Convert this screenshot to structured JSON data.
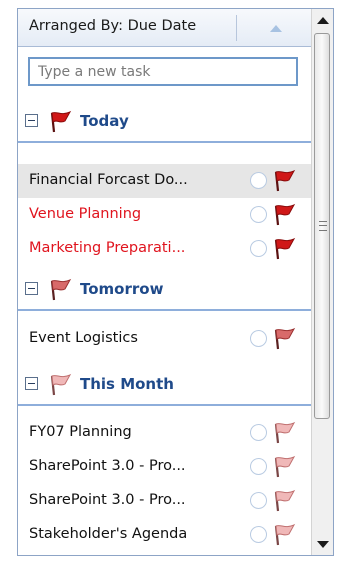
{
  "header": {
    "arranged_by": "Arranged By: Due Date",
    "sort_icon": "sort-ascending-icon"
  },
  "new_task": {
    "placeholder": "Type a new task",
    "value": ""
  },
  "colors": {
    "accent_blue": "#1f4a8a",
    "overdue_red": "#e0141e",
    "flag_red": "#d01818",
    "flag_light": "#e8a8a8"
  },
  "groups": [
    {
      "label": "Today",
      "flag_icon": "flag-red-icon",
      "tasks": [
        {
          "name": "Financial Forcast Do...",
          "overdue": false,
          "selected": true,
          "flag_icon": "flag-red-icon"
        },
        {
          "name": "Venue Planning",
          "overdue": true,
          "selected": false,
          "flag_icon": "flag-red-icon"
        },
        {
          "name": "Marketing Preparati...",
          "overdue": true,
          "selected": false,
          "flag_icon": "flag-red-icon"
        }
      ]
    },
    {
      "label": "Tomorrow",
      "flag_icon": "flag-medium-icon",
      "tasks": [
        {
          "name": "Event Logistics",
          "overdue": false,
          "selected": false,
          "flag_icon": "flag-medium-icon"
        }
      ]
    },
    {
      "label": "This Month",
      "flag_icon": "flag-light-icon",
      "tasks": [
        {
          "name": "FY07 Planning",
          "overdue": false,
          "selected": false,
          "flag_icon": "flag-light-icon"
        },
        {
          "name": "SharePoint 3.0 - Pro...",
          "overdue": false,
          "selected": false,
          "flag_icon": "flag-light-icon"
        },
        {
          "name": "SharePoint 3.0 - Pro...",
          "overdue": false,
          "selected": false,
          "flag_icon": "flag-light-icon"
        },
        {
          "name": "Stakeholder's Agenda",
          "overdue": false,
          "selected": false,
          "flag_icon": "flag-light-icon"
        }
      ]
    }
  ]
}
